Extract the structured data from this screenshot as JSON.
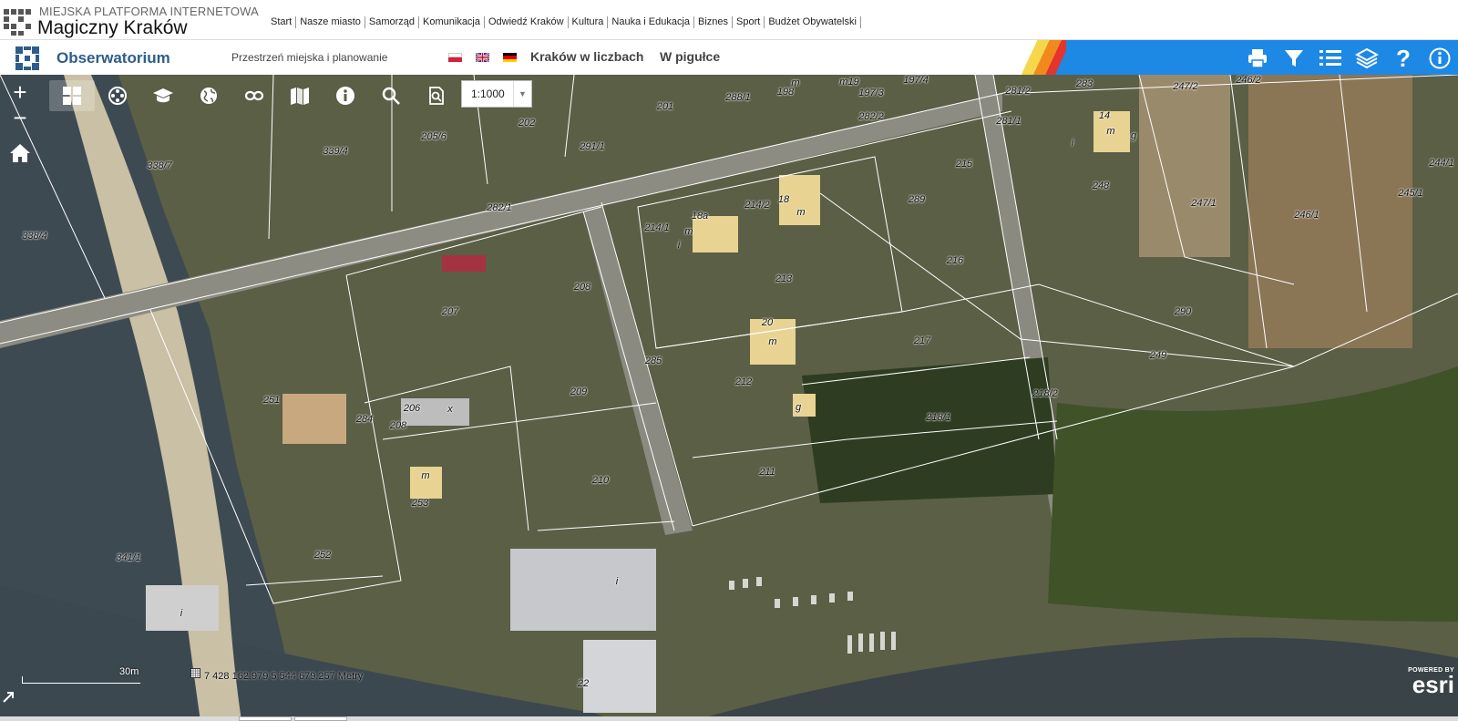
{
  "header": {
    "platform_label": "MIEJSKA PLATFORMA INTERNETOWA",
    "city_name": "Magiczny Kraków",
    "nav": [
      "Start",
      "Nasze miasto",
      "Samorząd",
      "Komunikacja",
      "Odwiedź Kraków",
      "Kultura",
      "Nauka i Edukacja",
      "Biznes",
      "Sport",
      "Budżet Obywatelski"
    ]
  },
  "appbar": {
    "title": "Obserwatorium",
    "section": "Przestrzeń miejska i planowanie",
    "languages": [
      "pl",
      "en",
      "de"
    ],
    "link_stats": "Kraków w liczbach",
    "link_glance": "W pigułce",
    "tools": [
      {
        "name": "print-icon"
      },
      {
        "name": "filter-icon"
      },
      {
        "name": "legend-list-icon"
      },
      {
        "name": "layers-icon"
      },
      {
        "name": "help-icon"
      },
      {
        "name": "info-icon"
      }
    ],
    "accent_color": "#1e88e5"
  },
  "map": {
    "zoom_in": "+",
    "zoom_out": "−",
    "scale_value": "1:1000",
    "scalebar_label": "30m",
    "coordinates": "7 428 162.979  5 544 679.257 Metry",
    "attribution_small": "POWERED BY",
    "attribution_brand": "esri",
    "map_tools": [
      {
        "name": "basemap-gallery-icon"
      },
      {
        "name": "film-reel-icon"
      },
      {
        "name": "graduation-cap-icon"
      },
      {
        "name": "globe-icon"
      },
      {
        "name": "link-icon"
      },
      {
        "name": "map-icon"
      },
      {
        "name": "identify-info-icon"
      },
      {
        "name": "search-icon"
      },
      {
        "name": "zoom-document-icon"
      }
    ],
    "parcels": [
      "338/7",
      "338/4",
      "339/4",
      "205/6",
      "202",
      "201",
      "291/1",
      "288/1",
      "198",
      "m",
      "m19",
      "197/3",
      "197/4",
      "282/2",
      "281/2",
      "283",
      "247/2",
      "246/2",
      "281/1",
      "14",
      "m",
      "g",
      "i",
      "215",
      "244/1",
      "245/1",
      "246/1",
      "247/1",
      "248",
      "18",
      "m",
      "214/2",
      "18a",
      "m",
      "214/1",
      "i",
      "289",
      "216",
      "282/1",
      "208",
      "207",
      "213",
      "20",
      "m",
      "212",
      "g",
      "285",
      "217",
      "290",
      "249",
      "218/2",
      "218/1",
      "251",
      "209",
      "206",
      "x",
      "284",
      "208",
      "m",
      "210",
      "211",
      "253",
      "252",
      "341/1",
      "i",
      "i",
      "22"
    ]
  }
}
